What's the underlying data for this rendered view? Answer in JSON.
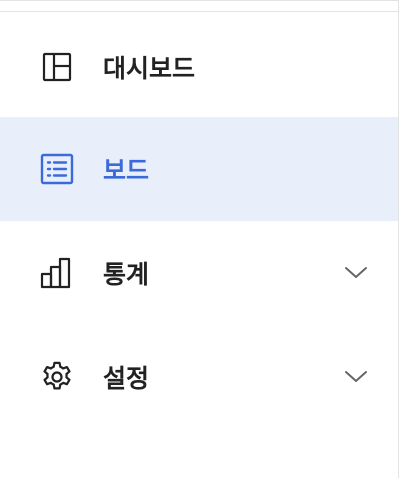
{
  "sidebar": {
    "items": [
      {
        "label": "대시보드",
        "icon": "dashboard-icon",
        "active": false,
        "expandable": false
      },
      {
        "label": "보드",
        "icon": "list-board-icon",
        "active": true,
        "expandable": false
      },
      {
        "label": "통계",
        "icon": "bar-chart-icon",
        "active": false,
        "expandable": true
      },
      {
        "label": "설정",
        "icon": "gear-icon",
        "active": false,
        "expandable": true
      }
    ]
  },
  "colors": {
    "active_bg": "#e9effa",
    "active_text": "#3a6bd8",
    "text": "#222222",
    "chevron": "#666666"
  }
}
